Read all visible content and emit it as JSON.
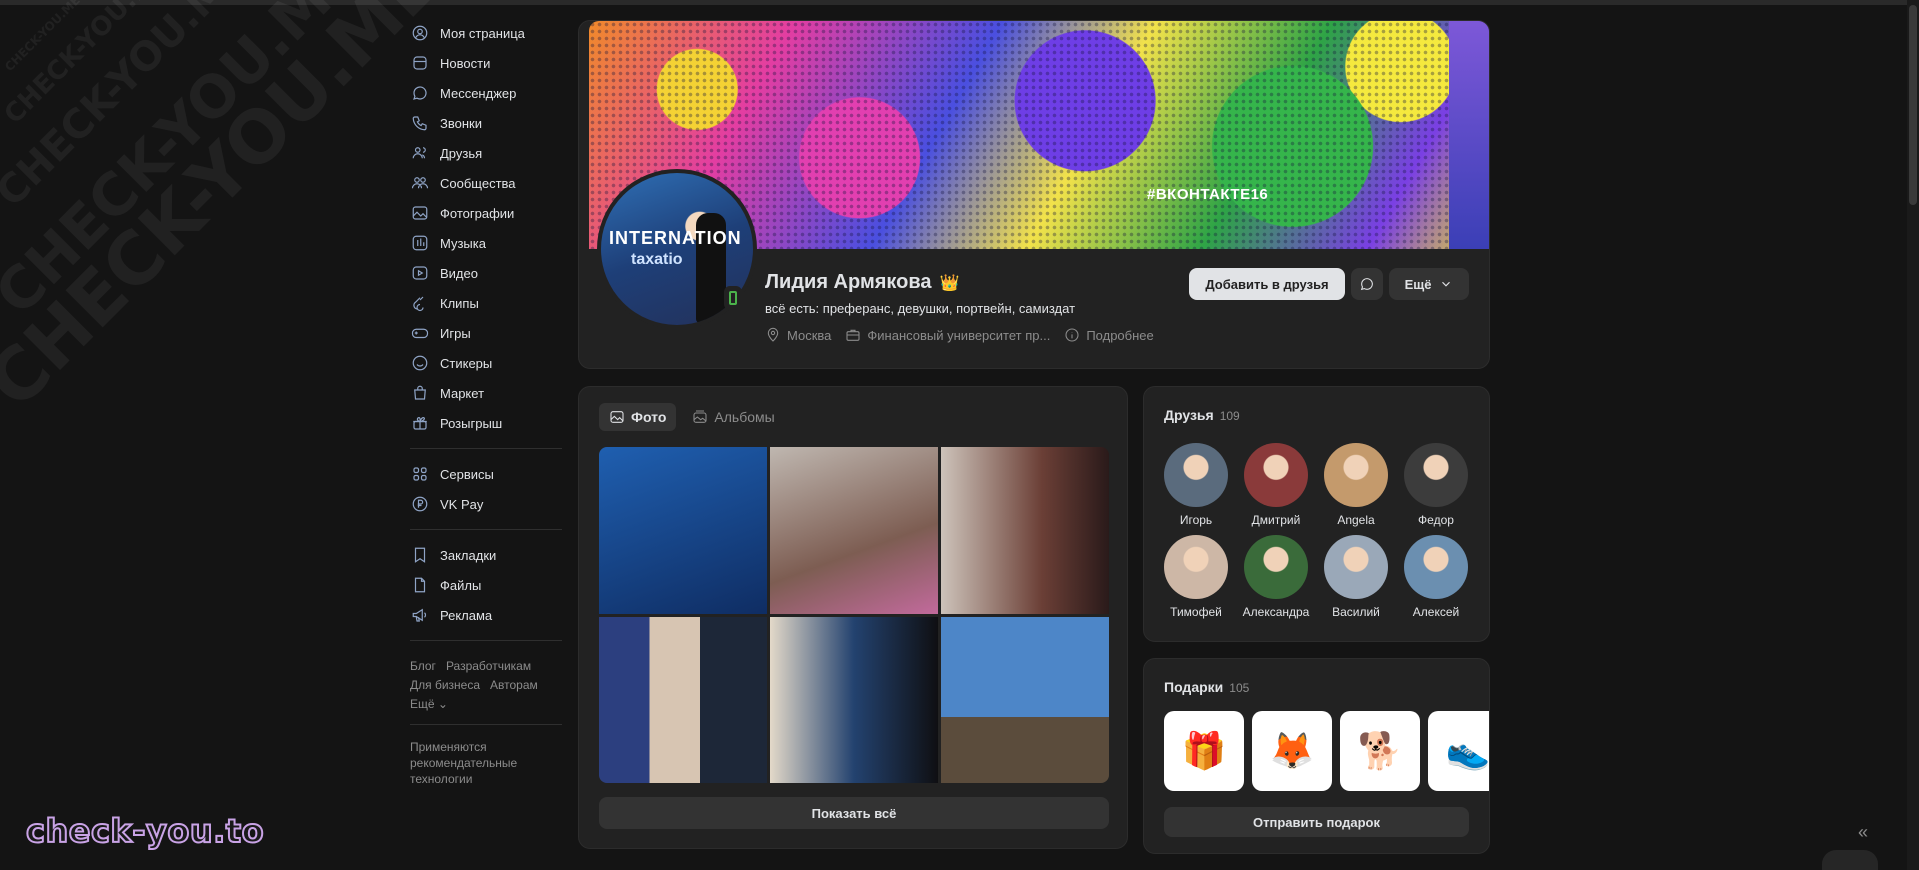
{
  "sidebar": {
    "items": [
      {
        "label": "Моя страница",
        "icon": "user-circle-icon"
      },
      {
        "label": "Новости",
        "icon": "news-icon"
      },
      {
        "label": "Мессенджер",
        "icon": "chat-icon"
      },
      {
        "label": "Звонки",
        "icon": "phone-icon"
      },
      {
        "label": "Друзья",
        "icon": "users-icon"
      },
      {
        "label": "Сообщества",
        "icon": "community-icon"
      },
      {
        "label": "Фотографии",
        "icon": "photo-icon"
      },
      {
        "label": "Музыка",
        "icon": "music-icon"
      },
      {
        "label": "Видео",
        "icon": "video-icon"
      },
      {
        "label": "Клипы",
        "icon": "clips-icon"
      },
      {
        "label": "Игры",
        "icon": "gamepad-icon"
      },
      {
        "label": "Стикеры",
        "icon": "smile-icon"
      },
      {
        "label": "Маркет",
        "icon": "bag-icon"
      },
      {
        "label": "Розыгрыш",
        "icon": "gift-icon"
      }
    ],
    "items2": [
      {
        "label": "Сервисы",
        "icon": "grid-icon"
      },
      {
        "label": "VK Pay",
        "icon": "ruble-icon"
      }
    ],
    "items3": [
      {
        "label": "Закладки",
        "icon": "bookmark-icon"
      },
      {
        "label": "Файлы",
        "icon": "file-icon"
      },
      {
        "label": "Реклама",
        "icon": "megaphone-icon"
      }
    ],
    "footer": {
      "blog": "Блог",
      "developers": "Разработчикам",
      "business": "Для бизнеса",
      "authors": "Авторам",
      "more": "Ещё ⌄",
      "note": "Применяются рекомендательные технологии"
    }
  },
  "profile": {
    "cover_tag": "#ВКОНТАКТЕ16",
    "avatar_text1": "INTERNATION",
    "avatar_text2": "taxatio",
    "name": "Лидия Армякова",
    "crown": "👑",
    "status": "всё есть: преферанс, девушки, портвейн, самиздат",
    "city": "Москва",
    "university": "Финансовый университет пр...",
    "details": "Подробнее",
    "add_friend": "Добавить в друзья",
    "more": "Ещё"
  },
  "photos": {
    "tab_photo": "Фото",
    "tab_albums": "Альбомы",
    "show_all": "Показать всё"
  },
  "friends": {
    "title": "Друзья",
    "count": "109",
    "list": [
      {
        "name": "Игорь",
        "color": "#5a6b7d"
      },
      {
        "name": "Дмитрий",
        "color": "#8a3a3a"
      },
      {
        "name": "Angela",
        "color": "#c49a6c"
      },
      {
        "name": "Федор",
        "color": "#3c3c3c"
      },
      {
        "name": "Тимофей",
        "color": "#cdb7a6"
      },
      {
        "name": "Александра",
        "color": "#3a6b3a"
      },
      {
        "name": "Василий",
        "color": "#9aa8b8"
      },
      {
        "name": "Алексей",
        "color": "#6b8fb0"
      }
    ]
  },
  "gifts": {
    "title": "Подарки",
    "count": "105",
    "items": [
      "🎁",
      "🦊",
      "🐕",
      "👟"
    ],
    "send": "Отправить подарок"
  },
  "watermark": {
    "text": "CHECK-YOU.ME",
    "brand": "check-you.to"
  },
  "collapse_label": "«"
}
